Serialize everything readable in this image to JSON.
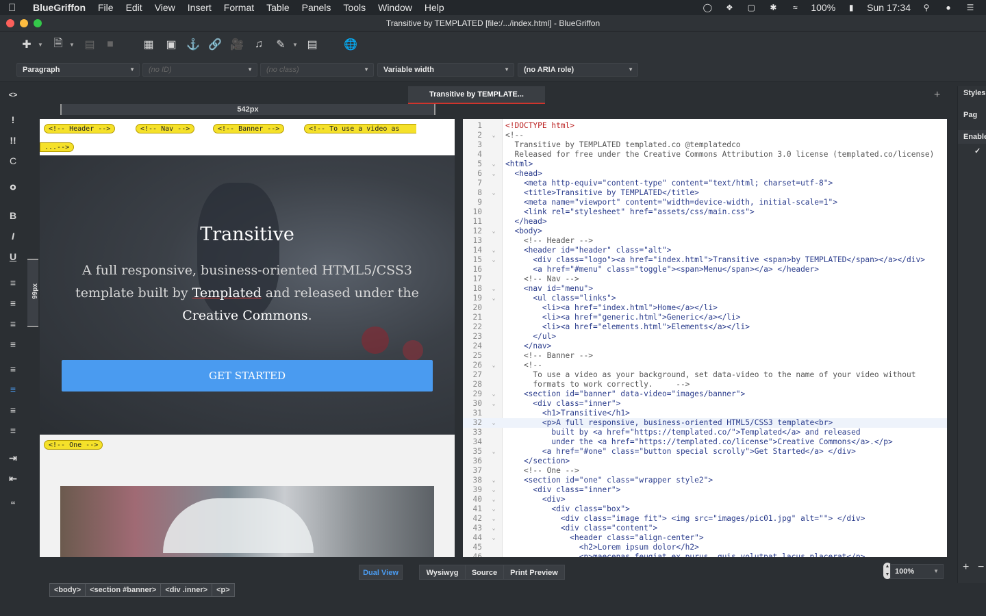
{
  "menubar": {
    "app": "BlueGriffon",
    "items": [
      "File",
      "Edit",
      "View",
      "Insert",
      "Format",
      "Table",
      "Panels",
      "Tools",
      "Window",
      "Help"
    ],
    "battery": "100%",
    "clock": "Sun 17:34"
  },
  "window": {
    "title": "Transitive by TEMPLATED [file:/.../index.html] - BlueGriffon"
  },
  "format_bar": {
    "paragraph": "Paragraph",
    "id": "(no ID)",
    "class": "(no class)",
    "width": "Variable width",
    "aria": "(no ARIA role)"
  },
  "tab": {
    "label": "Transitive by TEMPLATE..."
  },
  "ruler": {
    "width_label": "542px",
    "height_label": "99px"
  },
  "wysiwyg": {
    "comments": [
      "<!-- Header -->",
      "<!-- Nav -->",
      "<!-- Banner -->",
      "<!-- To use a video as",
      "...-->",
      "<!-- One -->"
    ],
    "banner_title": "Transitive",
    "banner_text_1": "A full responsive, business-oriented HTML5/CSS3 template built by ",
    "banner_link_1": "Templated",
    "banner_text_2": " and released under the ",
    "banner_link_2": "Creative Commons",
    "banner_text_3": ".",
    "button": "GET STARTED"
  },
  "source_lines": [
    "<!DOCTYPE html>",
    "<!--",
    "  Transitive by TEMPLATED templated.co @templatedco",
    "  Released for free under the Creative Commons Attribution 3.0 license (templated.co/license)",
    "<html>",
    "  <head>",
    "    <meta http-equiv=\"content-type\" content=\"text/html; charset=utf-8\">",
    "    <title>Transitive by TEMPLATED</title>",
    "    <meta name=\"viewport\" content=\"width=device-width, initial-scale=1\">",
    "    <link rel=\"stylesheet\" href=\"assets/css/main.css\">",
    "  </head>",
    "  <body>",
    "    <!-- Header -->",
    "    <header id=\"header\" class=\"alt\">",
    "      <div class=\"logo\"><a href=\"index.html\">Transitive <span>by TEMPLATED</span></a></div>",
    "      <a href=\"#menu\" class=\"toggle\"><span>Menu</span></a> </header>",
    "    <!-- Nav -->",
    "    <nav id=\"menu\">",
    "      <ul class=\"links\">",
    "        <li><a href=\"index.html\">Home</a></li>",
    "        <li><a href=\"generic.html\">Generic</a></li>",
    "        <li><a href=\"elements.html\">Elements</a></li>",
    "      </ul>",
    "    </nav>",
    "    <!-- Banner -->",
    "    <!--",
    "      To use a video as your background, set data-video to the name of your video without",
    "      formats to work correctly.     -->",
    "    <section id=\"banner\" data-video=\"images/banner\">",
    "      <div class=\"inner\">",
    "        <h1>Transitive</h1>",
    "        <p>A full responsive, business-oriented HTML5/CSS3 template<br>",
    "          built by <a href=\"https://templated.co/\">Templated</a> and released",
    "          under the <a href=\"https://templated.co/license\">Creative Commons</a>.</p>",
    "        <a href=\"#one\" class=\"button special scrolly\">Get Started</a> </div>",
    "    </section>",
    "    <!-- One -->",
    "    <section id=\"one\" class=\"wrapper style2\">",
    "      <div class=\"inner\">",
    "        <div>",
    "          <div class=\"box\">",
    "            <div class=\"image fit\"> <img src=\"images/pic01.jpg\" alt=\"\"> </div>",
    "            <div class=\"content\">",
    "              <header class=\"align-center\">",
    "                <h2>Lorem ipsum dolor</h2>",
    "                <p>maecenas feugiat ex purus, quis volutpat lacus placerat</p>"
  ],
  "view_modes": [
    "Dual View",
    "Wysiwyg",
    "Source",
    "Print Preview"
  ],
  "zoom": "100%",
  "breadcrumbs": [
    "<body>",
    "<section #banner>",
    "<div .inner>",
    "<p>"
  ],
  "right_panel": [
    "Styles",
    "Pag",
    "Enable",
    "✓"
  ],
  "colors": {
    "accent_tab": "#d0342c",
    "button": "#4a9bf0",
    "comment_tag": "#f5e12a",
    "dual_view": "#4a9bf0"
  }
}
